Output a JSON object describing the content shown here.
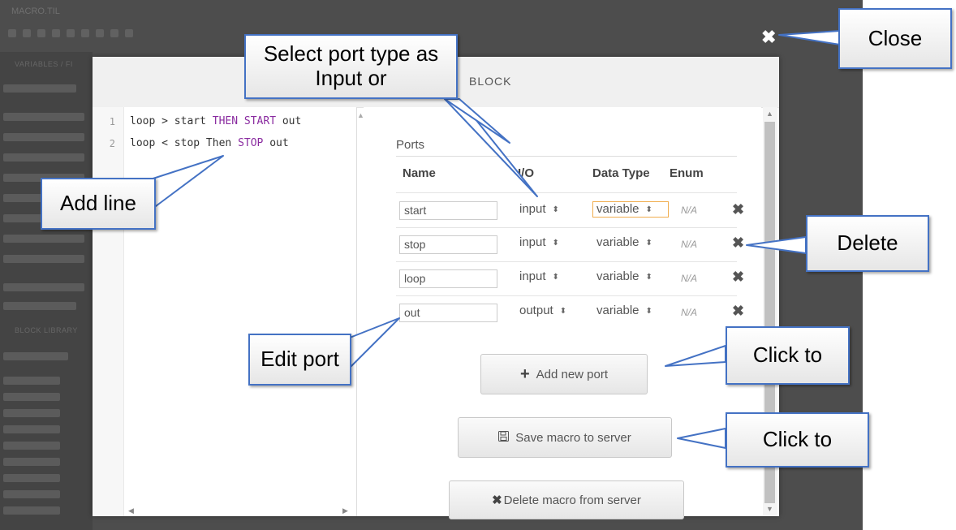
{
  "app": {
    "title": "MACRO.TIL",
    "side_heads": [
      "VARIABLES / FI",
      "BLOCK LIBRARY"
    ]
  },
  "modal": {
    "title": "BLOCK",
    "close_glyph": "✖"
  },
  "editor": {
    "lines": [
      {
        "num": "1",
        "parts": [
          {
            "t": "loop > start ",
            "k": false
          },
          {
            "t": "THEN START",
            "k": true
          },
          {
            "t": " out",
            "k": false
          }
        ]
      },
      {
        "num": "2",
        "parts": [
          {
            "t": "loop < stop Then ",
            "k": false
          },
          {
            "t": "STOP",
            "k": true
          },
          {
            "t": " out",
            "k": false
          }
        ]
      }
    ]
  },
  "ports": {
    "section_label": "Ports",
    "headers": {
      "name": "Name",
      "io": "I/O",
      "data_type": "Data Type",
      "enum": "Enum"
    },
    "rows": [
      {
        "name": "start",
        "io": "input",
        "data_type": "variable",
        "enum": "N/A",
        "focused": true
      },
      {
        "name": "stop",
        "io": "input",
        "data_type": "variable",
        "enum": "N/A",
        "focused": false
      },
      {
        "name": "loop",
        "io": "input",
        "data_type": "variable",
        "enum": "N/A",
        "focused": false
      },
      {
        "name": "out",
        "io": "output",
        "data_type": "variable",
        "enum": "N/A",
        "focused": false
      }
    ],
    "delete_glyph": "✖",
    "caret_glyph": "⬍",
    "add_port_icon": "plus-icon",
    "add_port_label": "Add new port",
    "save_icon": "floppy-disk-icon",
    "save_label": "Save macro to server",
    "delete_macro_icon": "x-icon",
    "delete_macro_label": "Delete macro from server"
  },
  "callouts": {
    "close": "Close",
    "select_port_type": "Select port type as Input or",
    "add_line": "Add line",
    "delete": "Delete",
    "edit_port": "Edit port",
    "click_to_add": "Click to",
    "click_to_save": "Click to"
  },
  "colors": {
    "callout_border": "#4472c4",
    "keyword": "#8a2ca0",
    "focus_border": "#f0ad4e"
  }
}
